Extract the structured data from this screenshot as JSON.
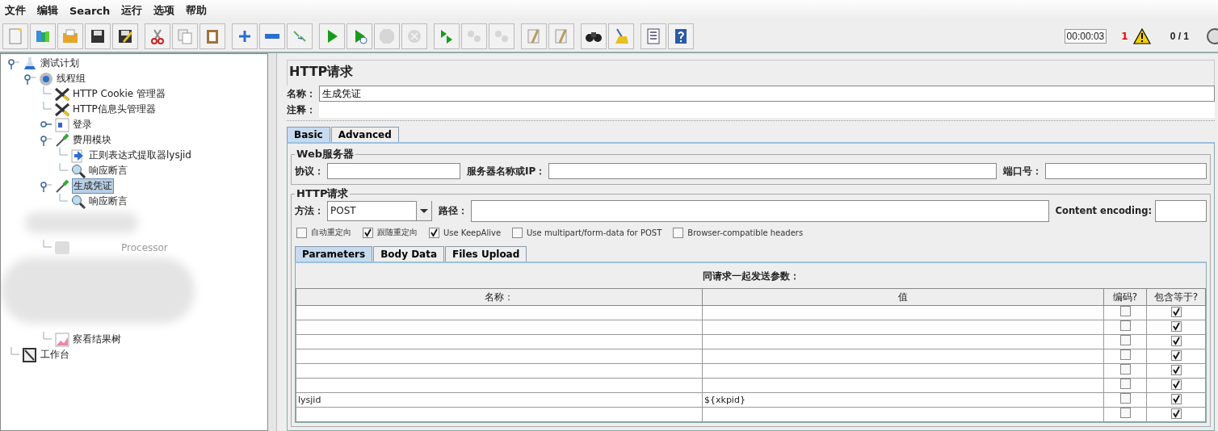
{
  "menu": [
    {
      "label": "文件"
    },
    {
      "label": "编辑"
    },
    {
      "label": "Search"
    },
    {
      "label": "运行"
    },
    {
      "label": "选项"
    },
    {
      "label": "帮助"
    }
  ],
  "toolbar": {
    "groups": [
      [
        {
          "kind": "new",
          "disabled": false
        },
        {
          "kind": "templates",
          "disabled": false
        },
        {
          "kind": "open",
          "disabled": false
        },
        {
          "kind": "save",
          "disabled": false
        },
        {
          "kind": "save-as",
          "disabled": false
        }
      ],
      [
        {
          "kind": "cut",
          "disabled": false
        },
        {
          "kind": "copy",
          "disabled": false
        },
        {
          "kind": "paste",
          "disabled": false
        }
      ],
      [
        {
          "kind": "expand",
          "disabled": false
        },
        {
          "kind": "collapse",
          "disabled": false
        },
        {
          "kind": "toggle",
          "disabled": false
        }
      ],
      [
        {
          "kind": "start",
          "disabled": false
        },
        {
          "kind": "start-no-timers",
          "disabled": false
        },
        {
          "kind": "stop",
          "disabled": true
        },
        {
          "kind": "shutdown",
          "disabled": true
        }
      ],
      [
        {
          "kind": "remote-start",
          "disabled": false
        },
        {
          "kind": "remote-stop",
          "disabled": true
        },
        {
          "kind": "remote-exit",
          "disabled": true
        }
      ],
      [
        {
          "kind": "clear",
          "disabled": false
        },
        {
          "kind": "clear-all",
          "disabled": false
        }
      ],
      [
        {
          "kind": "search",
          "disabled": false
        },
        {
          "kind": "reset-search",
          "disabled": false
        }
      ],
      [
        {
          "kind": "function-helper",
          "disabled": false
        },
        {
          "kind": "help",
          "disabled": false
        }
      ]
    ],
    "timer": "00:00:03",
    "warning_count": "1",
    "threads": "0 / 1"
  },
  "tree": [
    {
      "label": "测试计划",
      "kind": "plan",
      "selected": false,
      "children": [
        {
          "label": "线程组",
          "kind": "gear",
          "selected": false,
          "children": [
            {
              "label": "HTTP Cookie 管理器",
              "kind": "tools",
              "selected": false
            },
            {
              "label": "HTTP信息头管理器",
              "kind": "tools",
              "selected": false
            },
            {
              "label": "登录",
              "kind": "controller",
              "selected": false,
              "collapsed": true
            },
            {
              "label": "费用模块",
              "kind": "pipette",
              "selected": false,
              "children": [
                {
                  "label": "正则表达式提取器lysjid",
                  "kind": "extractor",
                  "selected": false
                },
                {
                  "label": "响应断言",
                  "kind": "magnifier",
                  "selected": false
                }
              ]
            },
            {
              "label": "生成凭证",
              "kind": "pipette",
              "selected": true,
              "children": [
                {
                  "label": "响应断言",
                  "kind": "magnifier",
                  "selected": false
                }
              ]
            },
            {
              "label": "Processor",
              "kind": "blurred",
              "selected": false
            },
            {
              "label": "察看结果树",
              "kind": "chart",
              "selected": false
            }
          ]
        }
      ]
    },
    {
      "label": "工作台",
      "kind": "workbench",
      "selected": false
    }
  ],
  "panel": {
    "title": "HTTP请求",
    "name_label": "名称：",
    "name_value": "生成凭证",
    "comment_label": "注释：",
    "tabs": [
      {
        "label": "Basic",
        "selected": true
      },
      {
        "label": "Advanced",
        "selected": false
      }
    ],
    "web_server": {
      "legend": "Web服务器",
      "protocol_label": "协议：",
      "server_label": "服务器名称或IP：",
      "port_label": "端口号："
    },
    "http_request": {
      "legend": "HTTP请求",
      "method_label": "方法：",
      "method_value": "POST",
      "path_label": "路径：",
      "encoding_label": "Content encoding:"
    },
    "options": [
      {
        "label": "自动重定向",
        "checked": false
      },
      {
        "label": "跟随重定向",
        "checked": true
      },
      {
        "label": "Use KeepAlive",
        "checked": true
      },
      {
        "label": "Use multipart/form-data for POST",
        "checked": false
      },
      {
        "label": "Browser-compatible headers",
        "checked": false
      }
    ],
    "sub_tabs": [
      {
        "label": "Parameters",
        "selected": true
      },
      {
        "label": "Body Data",
        "selected": false
      },
      {
        "label": "Files Upload",
        "selected": false
      }
    ],
    "table": {
      "caption": "同请求一起发送参数：",
      "columns": [
        "名称：",
        "值",
        "编码?",
        "包含等于?"
      ],
      "rows": [
        {
          "encode": false,
          "include_equals": true
        },
        {
          "encode": false,
          "include_equals": true
        },
        {
          "encode": false,
          "include_equals": true
        },
        {
          "encode": false,
          "include_equals": true
        },
        {
          "encode": false,
          "include_equals": true
        },
        {
          "encode": false,
          "include_equals": true
        },
        {
          "name": "lysjid",
          "value": "${xkpid}",
          "encode": false,
          "include_equals": true
        },
        {
          "encode": false,
          "include_equals": true
        }
      ]
    }
  }
}
